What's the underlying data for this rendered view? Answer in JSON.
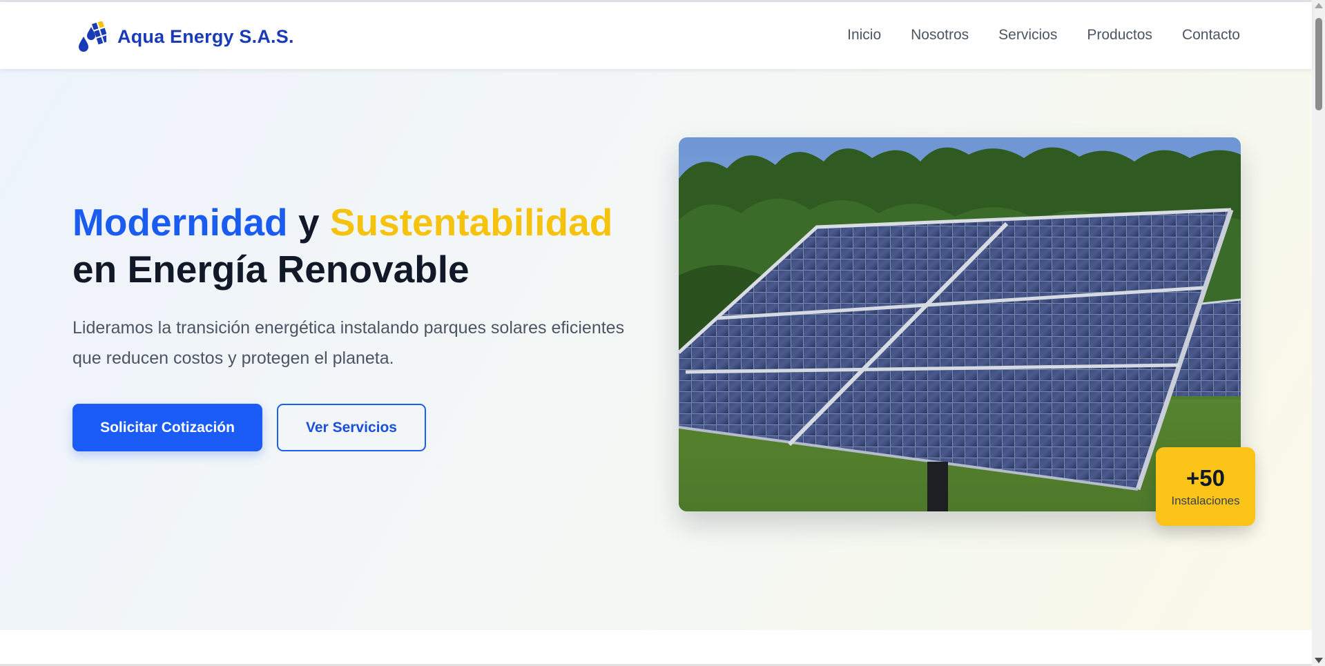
{
  "header": {
    "brand_name": "Aqua Energy S.A.S.",
    "logo_icon": "water-drops-solar-icon",
    "nav": [
      {
        "label": "Inicio"
      },
      {
        "label": "Nosotros"
      },
      {
        "label": "Servicios"
      },
      {
        "label": "Productos"
      },
      {
        "label": "Contacto"
      }
    ]
  },
  "hero": {
    "title_word_1": "Modernidad",
    "title_connector": "y",
    "title_word_2": "Sustentabilidad",
    "title_line_2": "en Energía Renovable",
    "description": "Lideramos la transición energética instalando parques solares eficientes que reducen costos y protegen el planeta.",
    "primary_button": "Solicitar Cotización",
    "secondary_button": "Ver Servicios",
    "image_subject": "solar-panel-field-photo",
    "stat": {
      "value": "+50",
      "label": "Instalaciones"
    }
  },
  "colors": {
    "brand": "#1a3bb5",
    "accent_blue": "#1a5cf5",
    "accent_yellow": "#fcc419"
  }
}
